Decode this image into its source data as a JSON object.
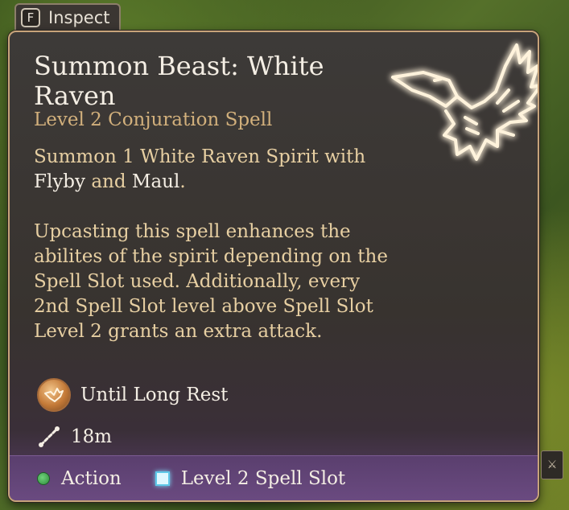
{
  "inspect": {
    "key": "F",
    "label": "Inspect"
  },
  "spell": {
    "title": "Summon Beast: White Raven",
    "subtitle": "Level 2 Conjuration Spell",
    "desc1_prefix": "Summon 1 White Raven Spirit with ",
    "desc1_flyby": "Flyby",
    "desc1_and": " and ",
    "desc1_maul": "Maul",
    "desc1_suffix": ".",
    "desc2": "Upcasting this spell enhances the abilites of the spirit depending on the Spell Slot used. Additionally, every 2nd Spell Slot level above Spell Slot Level 2 grants an extra attack.",
    "icon": "white-raven-icon",
    "icon_glow_color": "#ffb24a"
  },
  "stats": {
    "duration": {
      "icon": "summon-raven-icon",
      "label": "Until Long Rest"
    },
    "range": {
      "icon": "range-icon",
      "label": "18m"
    }
  },
  "cost": {
    "action": {
      "icon": "action-dot-icon",
      "label": "Action",
      "color": "#4fbf5c"
    },
    "slot": {
      "icon": "spell-slot-icon",
      "label": "Level 2 Spell Slot",
      "color": "#7ee0ff"
    }
  }
}
